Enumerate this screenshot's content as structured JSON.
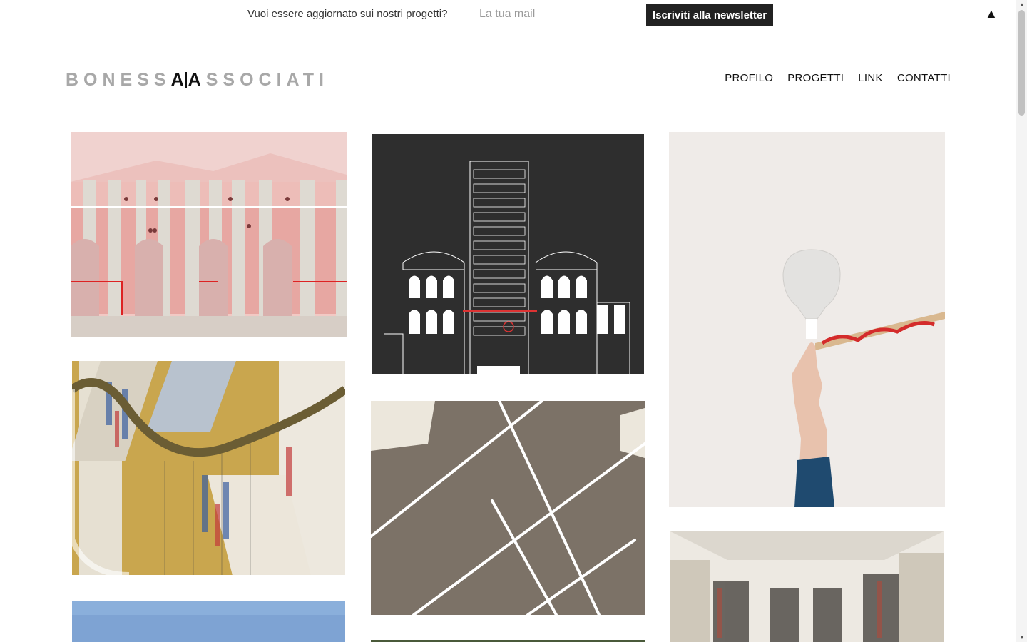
{
  "newsletter": {
    "question": "Vuoi essere aggiornato sui nostri progetti?",
    "email_placeholder": "La tua mail",
    "button_label": "Iscriviti alla newsletter",
    "toggle_glyph": "▲"
  },
  "header": {
    "logo_left": "BONESS",
    "logo_mark_a1": "A",
    "logo_mark_a2": "A",
    "logo_right": "SSOCIATI",
    "nav": [
      {
        "label": "PROFILO"
      },
      {
        "label": "PROGETTI"
      },
      {
        "label": "LINK"
      },
      {
        "label": "CONTATTI"
      }
    ]
  },
  "projects": [
    {
      "image": "pink-arcade-illustration",
      "accent": "#e8b8b4"
    },
    {
      "image": "dark-facade-drawing",
      "accent": "#2f2f2f"
    },
    {
      "image": "lamp-bulb-hand",
      "accent": "#f0ece8"
    },
    {
      "image": "bookstore-curved-rail",
      "accent": "#c9a64e"
    },
    {
      "image": "ceiling-light-lines",
      "accent": "#7d7368"
    },
    {
      "image": "bookstore-interior",
      "accent": "#e6e1d8"
    },
    {
      "image": "blue-sky",
      "accent": "#7ea0d0"
    }
  ],
  "scrollbar": {
    "up": "▲",
    "down": "▼"
  }
}
